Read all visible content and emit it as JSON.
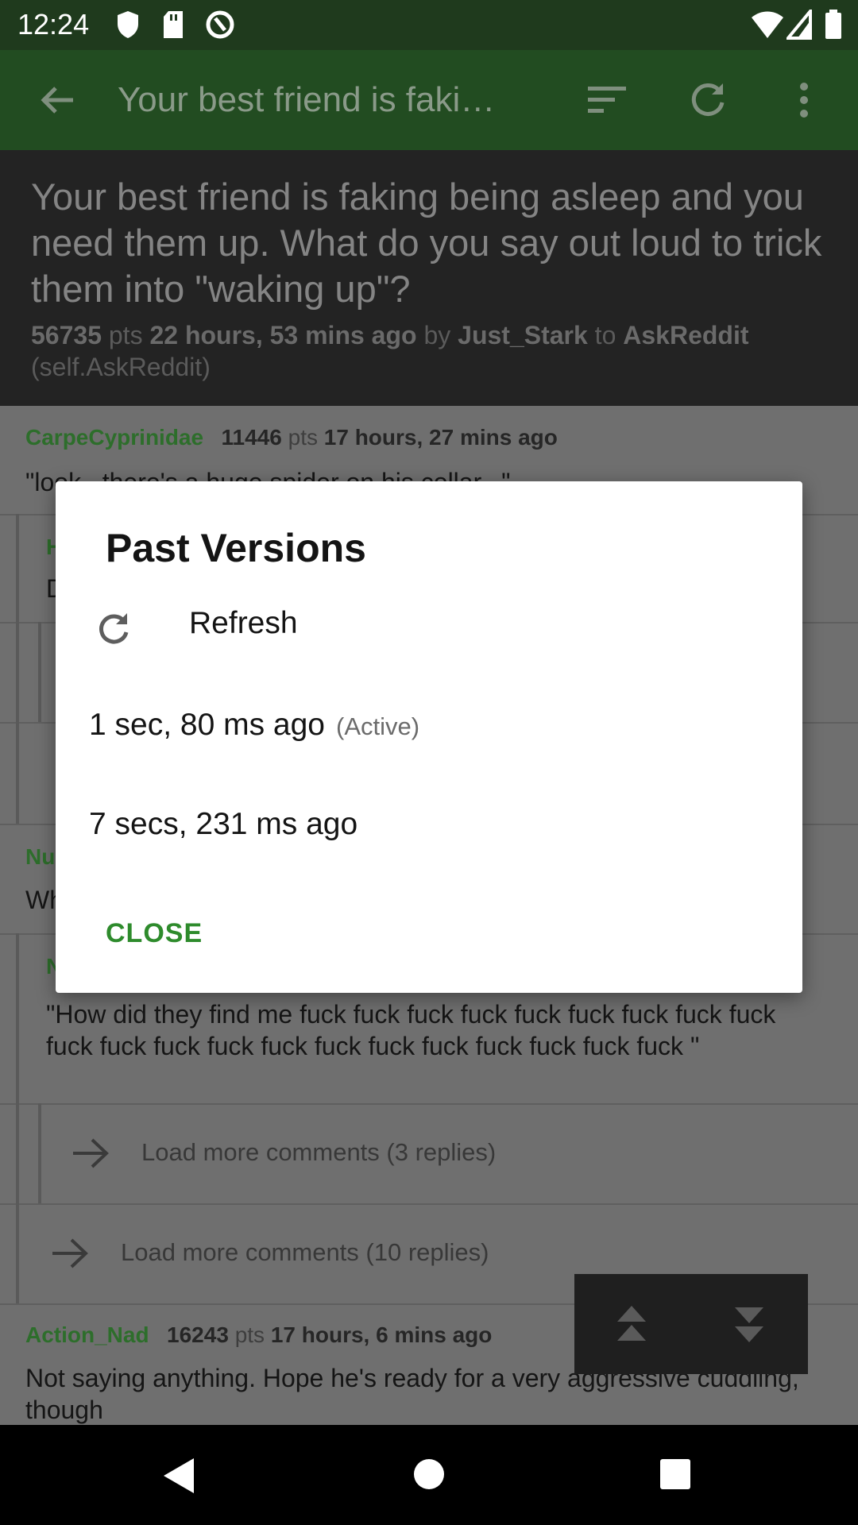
{
  "status_bar": {
    "time": "12:24",
    "icons": [
      "shield-icon",
      "sd-card-icon",
      "at-sign-icon",
      "wifi-icon",
      "signal-icon",
      "battery-icon"
    ]
  },
  "app_bar": {
    "title": "Your best friend is faki…",
    "icons": [
      "back-arrow-icon",
      "sort-icon",
      "refresh-icon",
      "more-vert-icon"
    ]
  },
  "post": {
    "title": "Your best friend is faking being asleep and you need them up. What do you say out loud to trick them into \"waking up\"?",
    "points": "56735",
    "pts_label": "pts",
    "time": "22 hours, 53 mins ago",
    "by_label": "by",
    "author": "Just_Stark",
    "to_label": "to",
    "subreddit": "AskReddit",
    "self_label": "(self.AskReddit)"
  },
  "comments": [
    {
      "author": "CarpeCyprinidae",
      "points": "11446",
      "pts_label": "pts",
      "time": "17 hours, 27 mins ago",
      "body": "\"look...there's a huge spider on his collar...\""
    },
    {
      "author": "H",
      "body": "D"
    },
    {
      "author": "Nu",
      "body": "Wh"
    },
    {
      "author": "N",
      "body": "\"How did they find me fuck fuck fuck fuck fuck fuck fuck fuck fuck fuck fuck fuck fuck fuck fuck fuck fuck fuck fuck fuck fuck \""
    },
    {
      "author": "Action_Nad",
      "points": "16243",
      "pts_label": "pts",
      "time": "17 hours, 6 mins ago",
      "body": "Not saying anything.  Hope he's ready for a very aggressive cuddling, though"
    }
  ],
  "load_more": [
    "Load more comments (3 replies)",
    "Load more comments (10 replies)"
  ],
  "dialog": {
    "title": "Past Versions",
    "refresh_label": "Refresh",
    "versions": [
      {
        "label": "1 sec, 80 ms ago",
        "status": "(Active)"
      },
      {
        "label": "7 secs, 231 ms ago",
        "status": ""
      }
    ],
    "close_label": "CLOSE"
  },
  "colors": {
    "accent_green": "#2e8b2c",
    "app_bar": "#224c21",
    "status_bar": "#1f3a1d"
  }
}
